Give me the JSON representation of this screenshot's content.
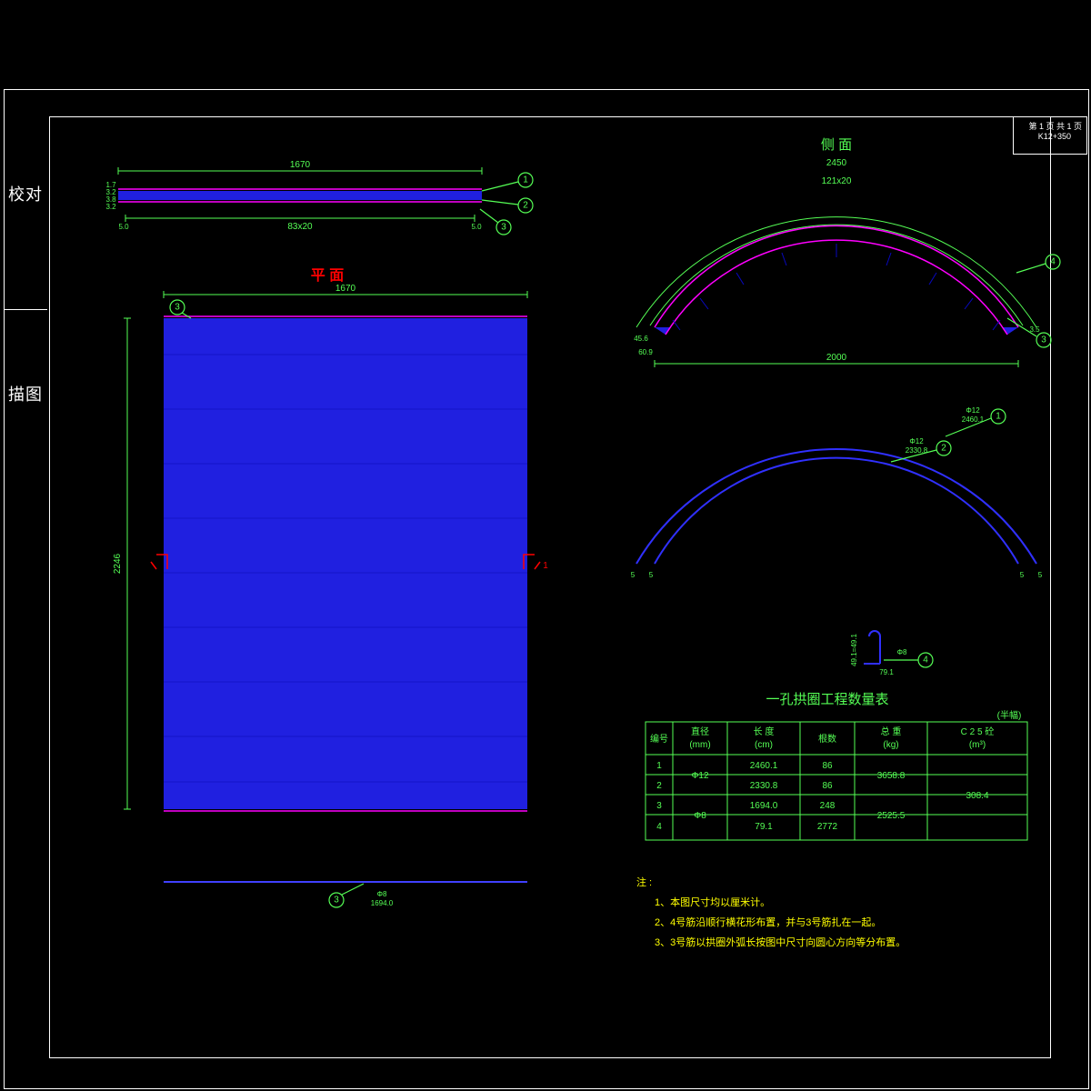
{
  "page": {
    "label": "第 1 页  共 1 页",
    "drawing_no": "K12+350"
  },
  "sidebar": {
    "l1": "校对",
    "l2": "描图"
  },
  "views": {
    "plan_title": "平  面",
    "side_title": "侧  面",
    "top_dim": "1670",
    "top_span": "83x20",
    "top_left_dims": [
      "1.7",
      "3.2",
      "3.8",
      "3.2"
    ],
    "top_edge": [
      "5.0",
      "5.0"
    ],
    "plan_dim_top": "1670",
    "plan_height": "2246",
    "footer_bar": {
      "tag": "3",
      "dia": "Φ8",
      "len": "1694.0"
    },
    "side_dims": {
      "outer": "2450",
      "inner": "121x20",
      "span": "2000",
      "edge_l": "60.9",
      "edge_l2": "45.6",
      "edge_r": "3.5",
      "edge_r2": "3.5"
    },
    "rebar_arcs": {
      "outer": {
        "tag": "1",
        "dia": "Φ12",
        "len": "2460.1"
      },
      "inner": {
        "tag": "2",
        "dia": "Φ12",
        "len": "2330.8"
      },
      "arc_ends": "5"
    },
    "hook": {
      "tag": "4",
      "dia": "Φ8",
      "len": "79.1",
      "h": "49.1=49.1"
    }
  },
  "table": {
    "title": "一孔拱圈工程数量表",
    "unit": "(半幅)",
    "headers": [
      "编号",
      "直径\n(mm)",
      "长 度\n(cm)",
      "根数",
      "总 重\n(kg)",
      "C 2 5 砼\n(m³)"
    ],
    "rows": [
      [
        "1",
        "Φ12",
        "2460.1",
        "86",
        "3658.8",
        "308.4"
      ],
      [
        "2",
        "",
        "2330.8",
        "86",
        "",
        ""
      ],
      [
        "3",
        "Φ8",
        "1694.0",
        "248",
        "2525.5",
        ""
      ],
      [
        "4",
        "",
        "79.1",
        "2772",
        "",
        ""
      ]
    ]
  },
  "notes": {
    "head": "注 :",
    "n1": "1、本图尺寸均以厘米计。",
    "n2": "2、4号筋沿顺行横花形布置，并与3号筋扎在一起。",
    "n3": "3、3号筋以拱圈外弧长按图中尺寸向圆心方向等分布置。"
  },
  "callouts": {
    "c1": "1",
    "c2": "2",
    "c3": "3",
    "c4": "4"
  }
}
